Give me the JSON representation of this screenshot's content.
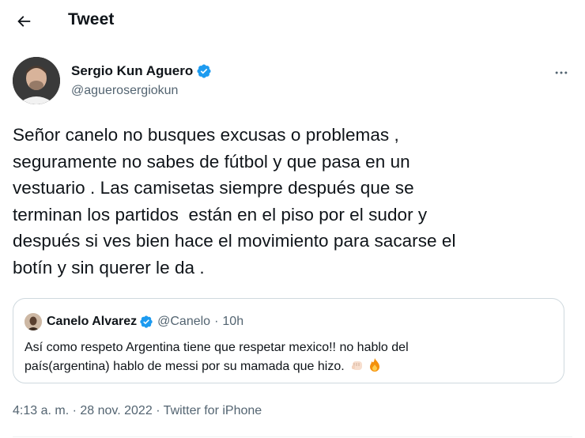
{
  "header": {
    "back_icon": "arrow-left-icon",
    "title": "Tweet"
  },
  "author": {
    "name": "Sergio Kun Aguero",
    "handle": "@aguerosergiokun",
    "verified": true,
    "verified_color": "#1d9bf0"
  },
  "more_icon": "ellipsis-icon",
  "tweet": {
    "text": "Señor canelo no busques excusas o problemas ,\nseguramente no sabes de fútbol y que pasa en un\nvestuario . Las camisetas siempre después que se\nterminan los partidos  están en el piso por el sudor y\ndespués si ves bien hace el movimiento para sacarse el\nbotín y sin querer le da ."
  },
  "quote": {
    "name": "Canelo Alvarez",
    "handle": "@Canelo",
    "separator": "·",
    "time": "10h",
    "verified": true,
    "text": "Así como respeto Argentina tiene que respetar mexico!! no hablo del\npaís(argentina) hablo de messi por su mamada que hizo. ",
    "emojis": [
      "fist-icon",
      "fire-icon"
    ]
  },
  "meta": {
    "time": "4:13 a. m.",
    "separator": "·",
    "date": "28 nov. 2022",
    "source": "Twitter for iPhone"
  },
  "colors": {
    "text_primary": "#0f1419",
    "text_secondary": "#536471",
    "border": "#cfd9de",
    "verified": "#1d9bf0"
  }
}
